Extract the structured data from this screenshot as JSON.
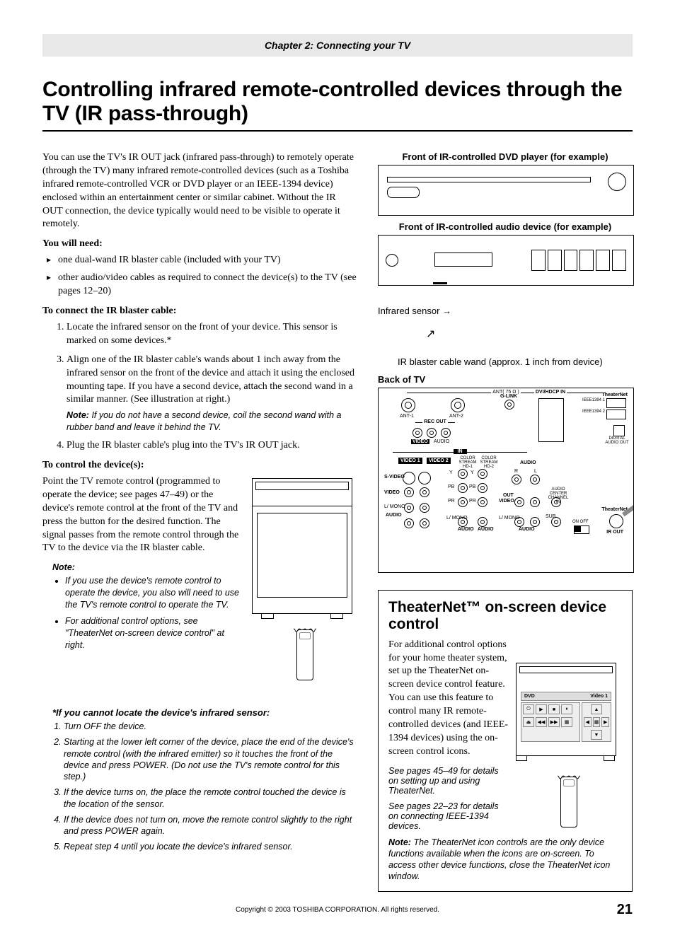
{
  "chapter": "Chapter 2: Connecting your TV",
  "title": "Controlling infrared remote-controlled devices through the TV (IR pass-through)",
  "intro": "You can use the TV's IR OUT jack (infrared pass-through) to remotely operate (through the TV) many infrared remote-controlled devices (such as a Toshiba infrared remote-controlled VCR or DVD player or an IEEE-1394 device) enclosed within an entertainment center or similar cabinet. Without the IR OUT connection, the device typically would need to be visible to operate it remotely.",
  "need_heading": "You will need:",
  "need_items": [
    "one dual-wand IR blaster cable (included with your TV)",
    "other audio/video cables as required to connect the device(s) to the TV (see pages 12–20)"
  ],
  "connect_heading": "To connect the IR blaster cable:",
  "connect_steps": {
    "s1": "Locate the infrared sensor on the front of your device. This sensor is marked on some devices.*",
    "s3": "Align one of the IR blaster cable's wands about 1 inch away from the infrared sensor on the front of the device and attach it using the enclosed mounting tape. If you have a second device, attach the second wand in a similar manner. (See illustration at right.)",
    "note": "If you do not have a second device, coil the second wand with a rubber band and leave it behind the TV.",
    "s4": "Plug the IR blaster cable's plug into the TV's IR OUT jack."
  },
  "note_label": "Note:",
  "control_heading": "To control the device(s):",
  "control_para": "Point the TV remote control (programmed to operate the device; see pages 47–49) or the device's remote control at the front of the TV and press the button for the desired function. The signal passes from the remote control through the TV to the device via the IR blaster cable.",
  "control_note_items": [
    "If you use the device's remote control to operate the device, you also will need to use the TV's remote control to operate the TV.",
    "For additional control options, see \"TheaterNet on-screen device control\" at right."
  ],
  "sensor_heading": "*If you cannot locate the device's infrared sensor:",
  "sensor_steps": [
    "Turn OFF the device.",
    "Starting at the lower left corner of the device, place the end of the device's remote control (with the infrared emitter) so it touches the front of the device and press POWER. (Do not use the TV's remote control for this step.)",
    "If the device turns on, the place the remote control touched the device is the location of the sensor.",
    "If the device does not turn on, move the remote control slightly to the right and press POWER again.",
    "Repeat step 4 until you locate the device's infrared sensor."
  ],
  "diagram": {
    "dvd_front": "Front of IR-controlled DVD player (for example)",
    "audio_front": "Front of IR-controlled audio device (for example)",
    "infrared_sensor": "Infrared sensor",
    "wand_note": "IR blaster cable wand (approx. 1 inch from device)",
    "back_tv": "Back of TV",
    "labels": {
      "ant": "ANT( 75 Ω )",
      "ant1": "ANT-1",
      "ant2": "ANT-2",
      "glink": "G-LINK",
      "dvi": "DVI/HDCP IN",
      "theaternet": "TheaterNet",
      "ieee1": "IEEE1394 1",
      "ieee2": "IEEE1394 2",
      "digital": "DIGITAL AUDIO OUT",
      "recout": "REC OUT",
      "video": "VIDEO",
      "audio": "AUDIO",
      "in": "IN",
      "video1": "VIDEO 1",
      "video2": "VIDEO 2",
      "colorstream1": "COLOR STREAM HD-1",
      "colorstream2": "COLOR STREAM HD-2",
      "svideo": "S-VIDEO",
      "r": "R",
      "l": "L",
      "lmono": "L/ MONO",
      "out": "OUT",
      "center": "AUDIO CENTER CHANNEL IN",
      "sub": "SUB",
      "onoff": "ON  OFF",
      "irout": "IR OUT",
      "y": "Y",
      "pb": "PB",
      "pr": "PR"
    }
  },
  "theater": {
    "heading": "TheaterNet™ on-screen device control",
    "para": "For additional control options for your home theater system, set up the TheaterNet on-screen device control feature. You can use this feature to control many IR remote-controlled devices (and IEEE-1394 devices) using the on-screen control icons.",
    "see1": "See pages 45–49 for details on setting up and using TheaterNet.",
    "see2": "See pages 22–23 for details on connecting IEEE-1394 devices.",
    "note": "The TheaterNet icon controls are the only device functions available when the icons are on-screen. To access other device functions, close the TheaterNet icon window.",
    "osd_dvd": "DVD",
    "osd_video1": "Video 1"
  },
  "copyright": "Copyright © 2003 TOSHIBA CORPORATION. All rights reserved.",
  "page_num": "21"
}
